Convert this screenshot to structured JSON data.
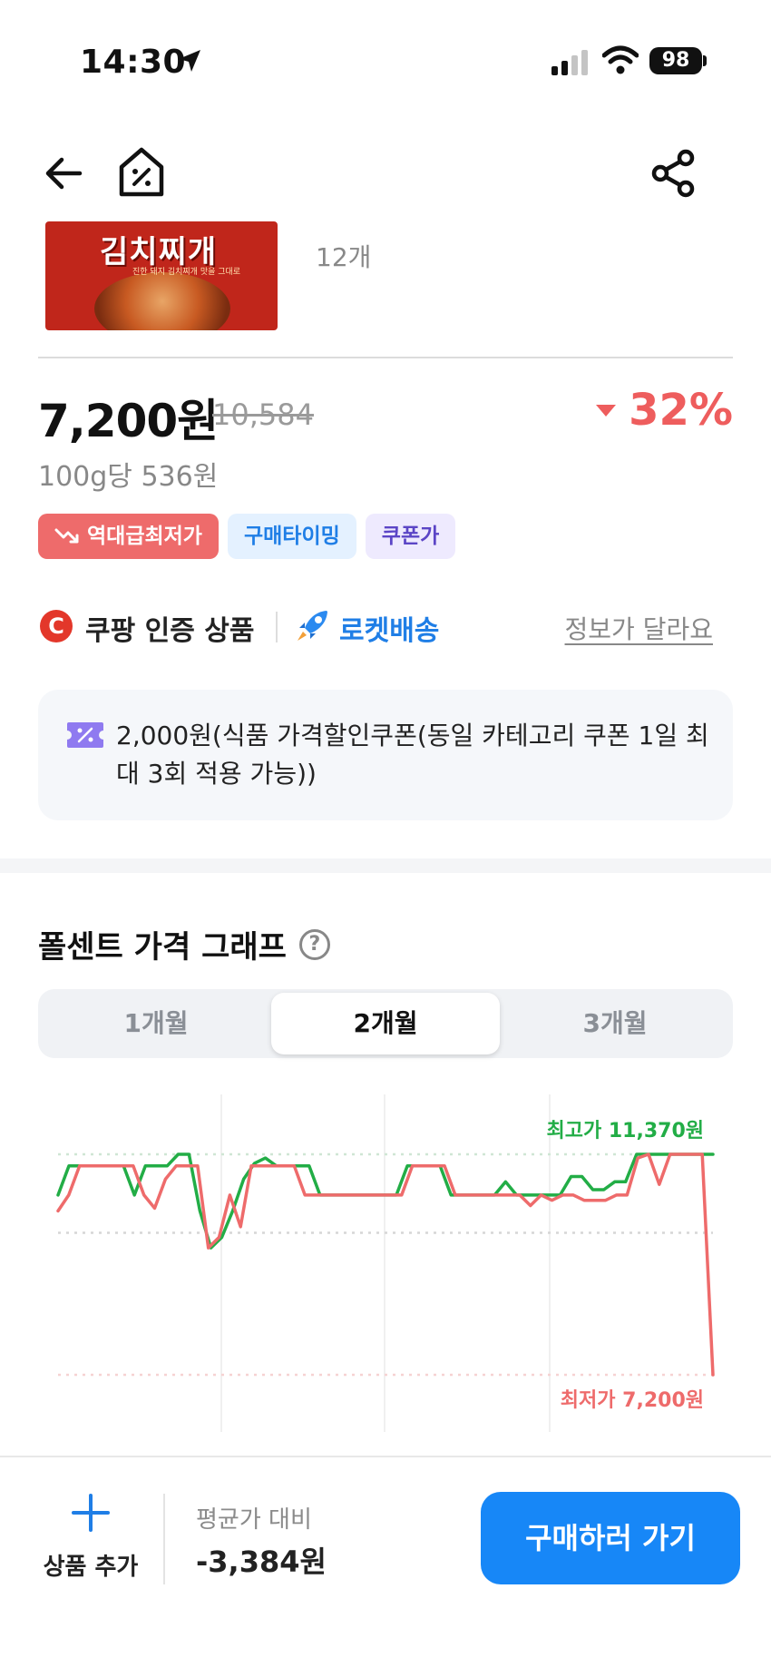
{
  "status_bar": {
    "time": "14:30",
    "battery": "98"
  },
  "product": {
    "thumb_name": "김치찌개",
    "thumb_sub": "진한 돼지 김치찌개 맛을 그대로",
    "quantity": "12개"
  },
  "price": {
    "current": "7,200원",
    "original": "10,584",
    "discount": "32%",
    "unit_price": "100g당 536원"
  },
  "tags": [
    {
      "label": "역대급최저가",
      "icon": "trend-down-icon"
    },
    {
      "label": "구매타이밍"
    },
    {
      "label": "쿠폰가"
    }
  ],
  "seller": {
    "verified": "쿠팡 인증 상품",
    "delivery": "로켓배송",
    "report_link": "정보가 달라요"
  },
  "coupon": {
    "text": "2,000원(식품 가격할인쿠폰(동일 카테고리 쿠폰 1일 최대 3회 적용 가능))"
  },
  "graph": {
    "title": "폴센트 가격 그래프",
    "tabs": [
      "1개월",
      "2개월",
      "3개월"
    ],
    "active_tab": "2개월",
    "max_label": "최고가 11,370원",
    "min_label": "최저가 7,200원"
  },
  "chart_data": {
    "type": "line",
    "ylim": [
      7200,
      11370
    ],
    "max_value": 11370,
    "min_value": 7200,
    "series": [
      {
        "color": "#22ad46",
        "values": [
          10600,
          11150,
          11150,
          11150,
          11150,
          11150,
          11150,
          10600,
          11150,
          11150,
          11150,
          11370,
          11370,
          10300,
          9600,
          9800,
          10300,
          10900,
          11200,
          11300,
          11150,
          11150,
          11150,
          11150,
          10600,
          10600,
          10600,
          10600,
          10600,
          10600,
          10600,
          10600,
          11150,
          11150,
          11150,
          11150,
          10600,
          10600,
          10600,
          10600,
          10600,
          10850,
          10600,
          10600,
          10600,
          10600,
          10600,
          10950,
          10950,
          10700,
          10700,
          10850,
          10850,
          11370,
          11370,
          11370,
          11370,
          11370,
          11370,
          11370,
          11370
        ]
      },
      {
        "color": "#ee6b6b",
        "values": [
          10300,
          10600,
          11150,
          11150,
          11150,
          11150,
          11150,
          11150,
          10600,
          10350,
          10900,
          11150,
          11150,
          11150,
          9600,
          9800,
          10600,
          10000,
          11150,
          11150,
          11150,
          11150,
          11150,
          10600,
          10600,
          10600,
          10600,
          10600,
          10600,
          10600,
          10600,
          10600,
          10600,
          11150,
          11150,
          11150,
          11150,
          10600,
          10600,
          10600,
          10600,
          10600,
          10600,
          10600,
          10400,
          10600,
          10500,
          10600,
          10600,
          10500,
          10500,
          10500,
          10600,
          10600,
          11300,
          11370,
          10800,
          11370,
          11370,
          11370,
          11370,
          7200
        ]
      }
    ]
  },
  "bottom": {
    "add_label": "상품 추가",
    "avg_label": "평균가 대비",
    "avg_value": "-3,384원",
    "buy_label": "구매하러 가기"
  },
  "colors": {
    "accent_blue": "#1787f7",
    "discount_red": "#ee5d5d",
    "max_green": "#22ad46"
  }
}
